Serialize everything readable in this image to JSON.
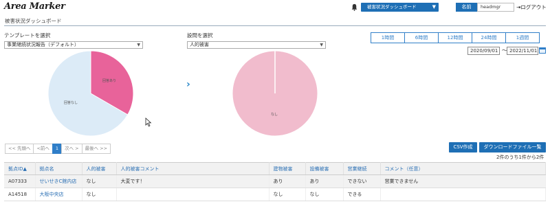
{
  "header": {
    "logo": "Area Marker",
    "dashboard_select": "被害状況ダッシュボード",
    "name_label": "名前",
    "name_value": "headmgr",
    "logout": "ログアウト"
  },
  "page_title": "被害状況ダッシュボード",
  "template": {
    "label": "テンプレートを選択",
    "value": "事業継続状況報告（デフォルト）"
  },
  "question": {
    "label": "設問を選択",
    "value": "人的被害"
  },
  "period_buttons": [
    "1時間",
    "6時間",
    "12時間",
    "24時間",
    "1週間"
  ],
  "date_from": "2020/09/01",
  "date_sep": "～",
  "date_to": "2022/11/01",
  "chart_data": [
    {
      "type": "pie",
      "slices": [
        {
          "label": "回答あり",
          "value": 1,
          "color": "#e8639a"
        },
        {
          "label": "回答なし",
          "value": 2,
          "color": "#dcebf7"
        }
      ]
    },
    {
      "type": "pie",
      "slices": [
        {
          "label": "なし",
          "value": 2,
          "color": "#f1bccd"
        }
      ]
    }
  ],
  "pager": [
    "<< 先頭へ",
    "<前へ",
    "1",
    "次へ >",
    "最後へ >>"
  ],
  "buttons": {
    "csv": "CSV作成",
    "download_list": "ダウンロードファイル一覧"
  },
  "result_count": "2件のうち1件から2件",
  "table": {
    "headers": [
      "拠点ID▲",
      "拠点名",
      "人的被害",
      "人的被害コメント",
      "建物被害",
      "設備被害",
      "営業継続",
      "コメント（任意）"
    ],
    "rows": [
      [
        "A07333",
        "せいせきC館内店",
        "なし",
        "大変です！",
        "あり",
        "あり",
        "できない",
        "営業できません"
      ],
      [
        "A14518",
        "大阪中央店",
        "なし",
        "",
        "なし",
        "なし",
        "できる",
        ""
      ]
    ]
  },
  "colors": {
    "accent": "#1e6fb5",
    "link": "#2a6fb4"
  }
}
